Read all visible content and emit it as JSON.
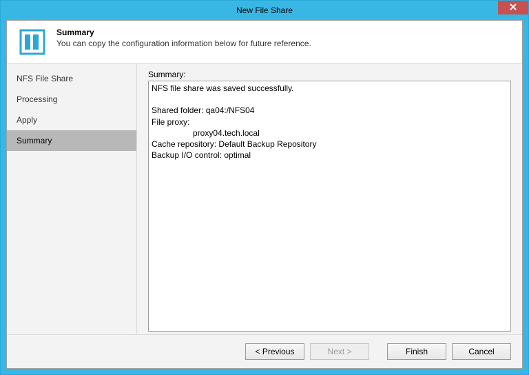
{
  "window": {
    "title": "New File Share"
  },
  "header": {
    "title": "Summary",
    "subtitle": "You can copy the configuration information below for future reference."
  },
  "nav": {
    "items": [
      {
        "label": "NFS File Share",
        "active": false
      },
      {
        "label": "Processing",
        "active": false
      },
      {
        "label": "Apply",
        "active": false
      },
      {
        "label": "Summary",
        "active": true
      }
    ]
  },
  "summary": {
    "label": "Summary:",
    "text": "NFS file share was saved successfully.\n\nShared folder: qa04:/NFS04\nFile proxy:\n                  proxy04.tech.local\nCache repository: Default Backup Repository\nBackup I/O control: optimal"
  },
  "buttons": {
    "previous": "< Previous",
    "next": "Next >",
    "finish": "Finish",
    "cancel": "Cancel"
  }
}
